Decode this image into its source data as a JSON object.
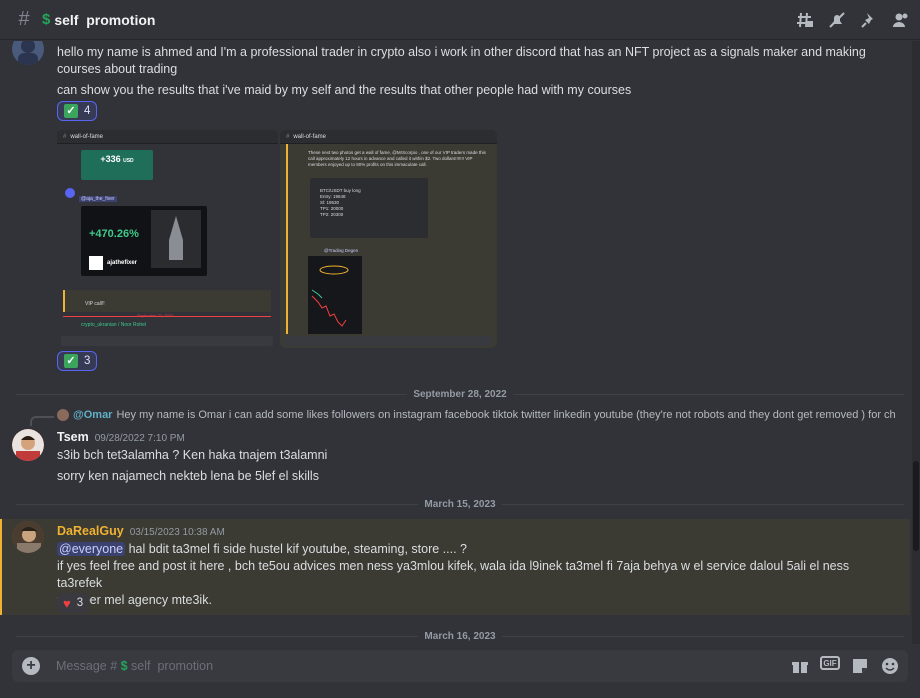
{
  "header": {
    "channel_emoji": "$",
    "channel_name": "self  promotion"
  },
  "messages": {
    "ahmed": {
      "line1": "hello my name is ahmed and I'm a professional trader in crypto also i work in other discord that has an NFT project as a signals maker and making",
      "line2": "courses about trading",
      "line3": "can show you the results that i've maid by my self and the results that other people had with my courses",
      "reaction1_count": "4",
      "reaction2_count": "3",
      "img1": {
        "channel": "wall-of-fame",
        "profit": "+336",
        "profit_unit": "USD",
        "handle": "@aja_the_fixer",
        "pct": "+470.26%",
        "ref": "ajathefixer",
        "reply_text": "VIP call!!",
        "footer_user": "crypto_ukranian / Noor Rohel",
        "date_label": "September 22, 2022"
      },
      "img2": {
        "channel": "wall-of-fame",
        "text": "These next two photos get a wall of fame, @MrScorpio , one of our VIP traders made this call approximately 12 hours in advance and called it within $2. Two dollars!!!!!!! VIP members enjoyed up to 80% profits on this immaculate call.",
        "pair": "BTC/USDT buy long",
        "entry": "Entry: 19648",
        "sl": "Sl: 19530",
        "tp1": "TP1: 20000",
        "tp2": "TP2: 20300",
        "mention": "@Trading Degen"
      }
    },
    "date1": "September 28, 2022",
    "reply": {
      "name": "@Omar",
      "text": "Hey my name is Omar i can add some likes followers on instagram facebook tiktok twitter linkedin youtube (they're not robots and they dont get removed ) for ch"
    },
    "tsem": {
      "name": "Tsem",
      "time": "09/28/2022 7:10 PM",
      "line1": "s3ib bch tet3alamha ? Ken haka tnajem t3alamni",
      "line2": "sorry ken najamech nekteb lena be 5lef el skills"
    },
    "date2": "March 15, 2023",
    "dareal": {
      "name": "DaRealGuy",
      "time": "03/15/2023 10:38 AM",
      "mention": "@everyone",
      "line1": " hal bdit ta3mel fi side hustel kif youtube, steaming, store .... ?",
      "line2": "if yes feel free and post it here , bch te5ou advices men ness ya3mlou kifek, wala ida l9inek ta3mel fi 7aja behya w el service daloul 5ali el ness ta3refek",
      "line3": "w kaber mel agency mte3ik.",
      "reaction_count": "3"
    },
    "date3": "March 16, 2023"
  },
  "composer": {
    "prefix": "Message # ",
    "emoji": "$",
    "channel": " self  promotion",
    "gif_label": "GIF"
  },
  "colors": {
    "accent": "#5865f2",
    "highlight": "#f0b232",
    "green": "#23a55a",
    "name_gold": "#f0b232"
  }
}
